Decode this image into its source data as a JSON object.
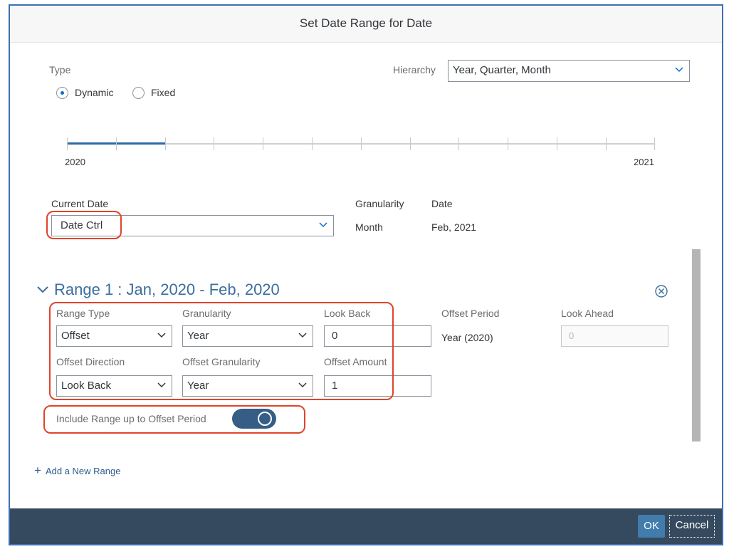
{
  "dialog": {
    "title": "Set Date Range for Date"
  },
  "type": {
    "label": "Type",
    "options": [
      {
        "label": "Dynamic",
        "selected": true
      },
      {
        "label": "Fixed",
        "selected": false
      }
    ]
  },
  "hierarchy": {
    "label": "Hierarchy",
    "value": "Year, Quarter, Month"
  },
  "timeline": {
    "start_label": "2020",
    "end_label": "2021",
    "selected_fraction": 0.167
  },
  "current_date": {
    "label": "Current Date",
    "value": "Date Ctrl"
  },
  "granularity_info": {
    "label": "Granularity",
    "value": "Month"
  },
  "date_info": {
    "label": "Date",
    "value": "Feb, 2021"
  },
  "range": {
    "title": "Range 1 : Jan, 2020 - Feb, 2020",
    "range_type": {
      "label": "Range Type",
      "value": "Offset"
    },
    "granularity": {
      "label": "Granularity",
      "value": "Year"
    },
    "look_back": {
      "label": "Look Back",
      "value": "0"
    },
    "offset_period": {
      "label": "Offset Period",
      "value": "Year (2020)"
    },
    "look_ahead": {
      "label": "Look Ahead",
      "placeholder": "0"
    },
    "offset_direction": {
      "label": "Offset Direction",
      "value": "Look Back"
    },
    "offset_granularity": {
      "label": "Offset Granularity",
      "value": "Year"
    },
    "offset_amount": {
      "label": "Offset Amount",
      "value": "1"
    },
    "include_range": {
      "label": "Include Range up to Offset Period",
      "on": true
    }
  },
  "add_range": {
    "label": "Add a New Range"
  },
  "footer": {
    "ok_label": "OK",
    "cancel_label": "Cancel"
  },
  "colors": {
    "accent": "#3c6e9e",
    "footer": "#354a5f",
    "highlight": "#e0442a",
    "toggle_on": "#355d86"
  }
}
